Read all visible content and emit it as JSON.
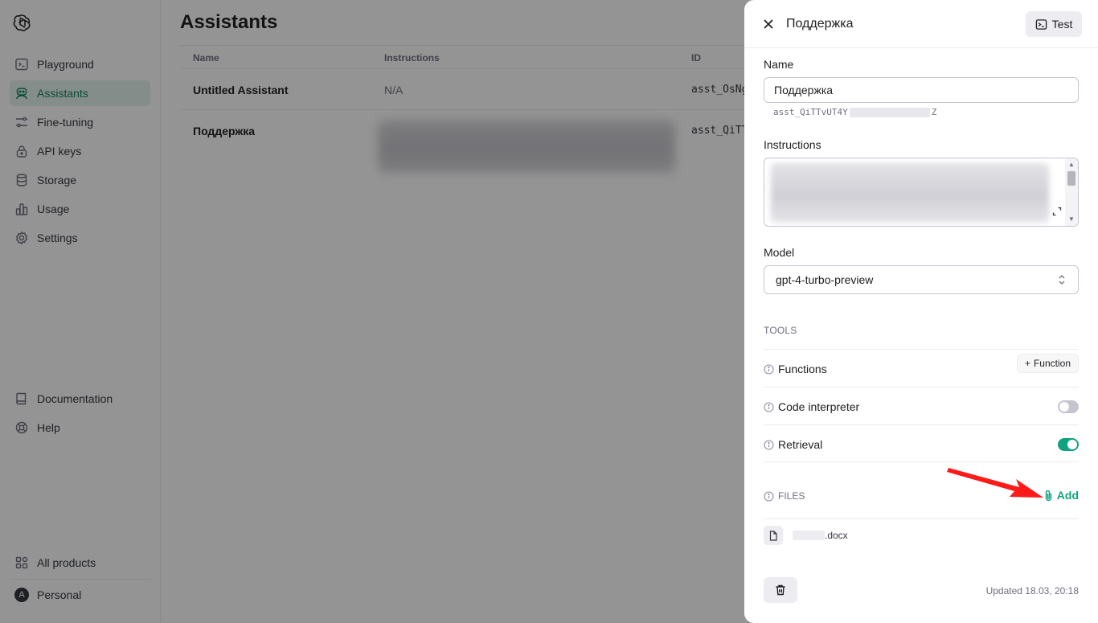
{
  "sidebar": {
    "items": [
      {
        "label": "Playground",
        "icon": "terminal-icon",
        "active": false
      },
      {
        "label": "Assistants",
        "icon": "robot-icon",
        "active": true
      },
      {
        "label": "Fine-tuning",
        "icon": "sliders-icon",
        "active": false
      },
      {
        "label": "API keys",
        "icon": "lock-icon",
        "active": false
      },
      {
        "label": "Storage",
        "icon": "database-icon",
        "active": false
      },
      {
        "label": "Usage",
        "icon": "bar-chart-icon",
        "active": false
      },
      {
        "label": "Settings",
        "icon": "gear-icon",
        "active": false
      }
    ],
    "bottom": [
      {
        "label": "Documentation",
        "icon": "book-icon"
      },
      {
        "label": "Help",
        "icon": "lifebuoy-icon"
      }
    ],
    "all_products": "All products",
    "account": {
      "avatar_letter": "A",
      "label": "Personal"
    }
  },
  "main": {
    "title": "Assistants",
    "columns": [
      "Name",
      "Instructions",
      "ID"
    ],
    "rows": [
      {
        "name": "Untitled Assistant",
        "instructions": "N/A",
        "id": "asst_OsNg"
      },
      {
        "name": "Поддержка",
        "instructions": "",
        "id": "asst_QiTT"
      }
    ]
  },
  "panel": {
    "title": "Поддержка",
    "test_label": "Test",
    "name_label": "Name",
    "name_value": "Поддержка",
    "id_prefix": "asst_QiTTvUT4Y",
    "id_suffix": "Z",
    "instructions_label": "Instructions",
    "model_label": "Model",
    "model_value": "gpt-4-turbo-preview",
    "tools_title": "TOOLS",
    "tools": {
      "functions": "Functions",
      "function_button": "Function",
      "code_interpreter": "Code interpreter",
      "code_interpreter_on": false,
      "retrieval": "Retrieval",
      "retrieval_on": true
    },
    "files_title": "FILES",
    "add_label": "Add",
    "file_name": ".docx",
    "updated": "Updated 18.03, 20:18"
  },
  "colors": {
    "accent": "#10a37f",
    "active_bg": "#e6f3ee",
    "arrow": "#ff1a1a"
  }
}
